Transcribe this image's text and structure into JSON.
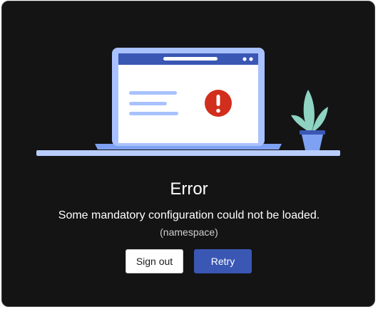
{
  "dialog": {
    "title": "Error",
    "message": "Some mandatory configuration could not be loaded.",
    "detail": "(namespace)"
  },
  "buttons": {
    "sign_out_label": "Sign out",
    "retry_label": "Retry"
  },
  "illustration": {
    "icons": [
      "laptop-icon",
      "error-icon",
      "plant-icon"
    ]
  },
  "colors": {
    "background": "#141414",
    "laptop_frame": "#a9c2ff",
    "laptop_bar": "#3a57b4",
    "error": "#d22e1d",
    "plant_leaf": "#8fd3c3",
    "pot": "#7ea1f2",
    "primary_button": "#3a57b4"
  }
}
